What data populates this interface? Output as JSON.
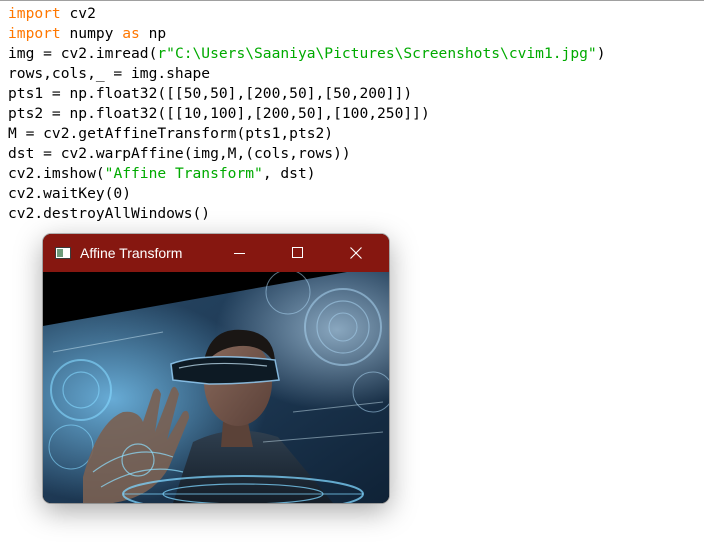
{
  "editor": {
    "lines": [
      [
        {
          "t": "import",
          "c": "kw"
        },
        {
          "t": " cv2",
          "c": ""
        }
      ],
      [
        {
          "t": "import",
          "c": "kw"
        },
        {
          "t": " numpy ",
          "c": ""
        },
        {
          "t": "as",
          "c": "kw"
        },
        {
          "t": " np",
          "c": ""
        }
      ],
      [
        {
          "t": "img = cv2.imread(",
          "c": ""
        },
        {
          "t": "r\"C:\\Users\\Saaniya\\Pictures\\Screenshots\\cvim1.jpg\"",
          "c": "str"
        },
        {
          "t": ")",
          "c": ""
        }
      ],
      [
        {
          "t": "rows,cols,_ = img.shape",
          "c": ""
        }
      ],
      [
        {
          "t": "pts1 = np.float32([[50,50],[200,50],[50,200]])",
          "c": ""
        }
      ],
      [
        {
          "t": "pts2 = np.float32([[10,100],[200,50],[100,250]])",
          "c": ""
        }
      ],
      [
        {
          "t": "M = cv2.getAffineTransform(pts1,pts2)",
          "c": ""
        }
      ],
      [
        {
          "t": "dst = cv2.warpAffine(img,M,(cols,rows))",
          "c": ""
        }
      ],
      [
        {
          "t": "cv2.imshow(",
          "c": ""
        },
        {
          "t": "\"Affine Transform\"",
          "c": "str"
        },
        {
          "t": ", dst)",
          "c": ""
        }
      ],
      [
        {
          "t": "cv2.waitKey(0)",
          "c": ""
        }
      ],
      [
        {
          "t": "cv2.destroyAllWindows()",
          "c": ""
        }
      ]
    ],
    "colors": {
      "keyword": "#ff7700",
      "string": "#00aa00",
      "text": "#000000"
    }
  },
  "cv_window": {
    "title": "Affine Transform",
    "titlebar_color": "#861710",
    "icons": {
      "app": "opencv-window-icon",
      "minimize": "minimize-icon",
      "maximize": "maximize-icon",
      "close": "close-icon"
    },
    "image": "affine-warped-photo"
  }
}
